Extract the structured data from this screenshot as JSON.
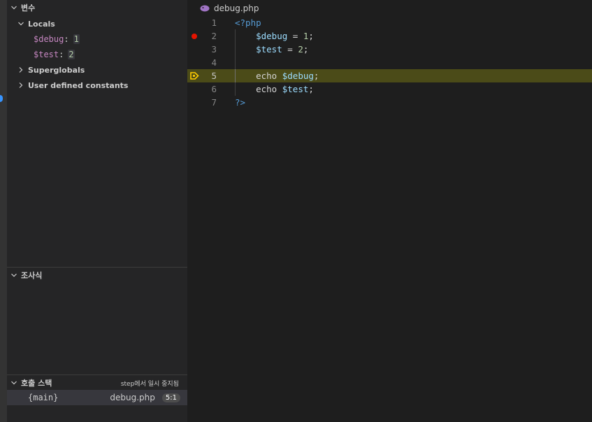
{
  "sidebar": {
    "variables": {
      "title": "변수",
      "locals_label": "Locals",
      "locals": [
        {
          "name": "$debug",
          "value": "1"
        },
        {
          "name": "$test",
          "value": "2"
        }
      ],
      "superglobals_label": "Superglobals",
      "constants_label": "User defined constants"
    },
    "watch": {
      "title": "조사식"
    },
    "callstack": {
      "title": "호출 스택",
      "status": "step에서 일시 중지됨",
      "frames": [
        {
          "function": "{main}",
          "file": "debug.php",
          "position": "5:1"
        }
      ]
    }
  },
  "editor": {
    "file_name": "debug.php",
    "breakpoint_line": 2,
    "current_line": 5,
    "lines": [
      {
        "number": "1",
        "open_tag": "<?php"
      },
      {
        "number": "2",
        "var": "$debug",
        "rest": " = ",
        "num": "1",
        "end": ";"
      },
      {
        "number": "3",
        "var": "$test",
        "rest": " = ",
        "num": "2",
        "end": ";"
      },
      {
        "number": "4"
      },
      {
        "number": "5",
        "kw": "echo ",
        "var": "$debug",
        "end": ";"
      },
      {
        "number": "6",
        "kw": "echo ",
        "var": "$test",
        "end": ";"
      },
      {
        "number": "7",
        "close_tag": "?>"
      }
    ]
  },
  "colors": {
    "breakpoint": "#e51400",
    "current_line": "#4b4b18",
    "exec_arrow": "#ffcc00"
  },
  "icons": [
    "chevron-down-icon",
    "chevron-right-icon",
    "php-icon",
    "breakpoint-icon",
    "execution-pointer-icon"
  ]
}
